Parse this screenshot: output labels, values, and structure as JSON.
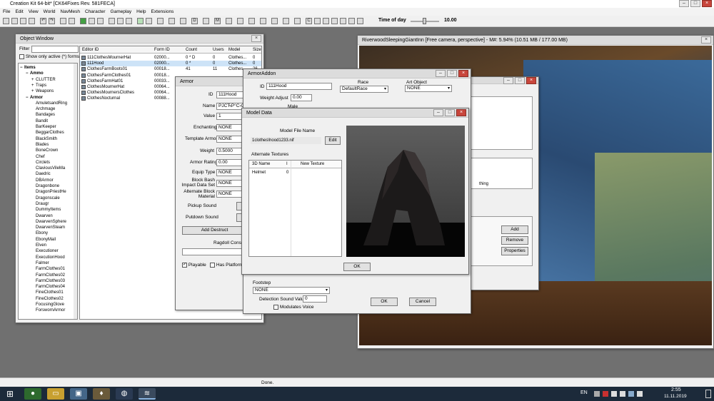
{
  "app": {
    "title": "Creation Kit 64-bit* [CK64Fixes Rev. 581FECA]",
    "menu": [
      "File",
      "Edit",
      "View",
      "World",
      "NavMesh",
      "Character",
      "Gameplay",
      "Help",
      "Extensions"
    ],
    "time_of_day_label": "Time of day",
    "time_of_day_value": "10.00",
    "status": "Done."
  },
  "object_window": {
    "title": "Object Window",
    "filter_label": "Filter",
    "show_active_label": "Show only active (*) forms",
    "tree": [
      {
        "label": "Items",
        "level": 0,
        "expander": "−"
      },
      {
        "label": "Ammo",
        "level": 1,
        "expander": "−"
      },
      {
        "label": "CLUTTER",
        "level": 2,
        "expander": "+"
      },
      {
        "label": "Traps",
        "level": 2,
        "expander": "+"
      },
      {
        "label": "Weapons",
        "level": 2,
        "expander": "+"
      },
      {
        "label": "Armor",
        "level": 1,
        "expander": "−"
      },
      {
        "label": "AmuletsandRing",
        "level": 2,
        "expander": ""
      },
      {
        "label": "Archmage",
        "level": 2,
        "expander": ""
      },
      {
        "label": "Bandages",
        "level": 2,
        "expander": ""
      },
      {
        "label": "Bandit",
        "level": 2,
        "expander": ""
      },
      {
        "label": "BarKeeper",
        "level": 2,
        "expander": ""
      },
      {
        "label": "BeggarClothes",
        "level": 2,
        "expander": ""
      },
      {
        "label": "BlackSmith",
        "level": 2,
        "expander": ""
      },
      {
        "label": "Blades",
        "level": 2,
        "expander": ""
      },
      {
        "label": "BoneCrown",
        "level": 2,
        "expander": ""
      },
      {
        "label": "Chef",
        "level": 2,
        "expander": ""
      },
      {
        "label": "Circlets",
        "level": 2,
        "expander": ""
      },
      {
        "label": "ClaviousVileMa",
        "level": 2,
        "expander": ""
      },
      {
        "label": "Daedric",
        "level": 2,
        "expander": ""
      },
      {
        "label": "DBArmor",
        "level": 2,
        "expander": ""
      },
      {
        "label": "Dragonbone",
        "level": 2,
        "expander": ""
      },
      {
        "label": "DragonPriestHe",
        "level": 2,
        "expander": ""
      },
      {
        "label": "Dragonscale",
        "level": 2,
        "expander": ""
      },
      {
        "label": "Draugr",
        "level": 2,
        "expander": ""
      },
      {
        "label": "DummyItems",
        "level": 2,
        "expander": ""
      },
      {
        "label": "Dwarven",
        "level": 2,
        "expander": ""
      },
      {
        "label": "DwarvenSphere",
        "level": 2,
        "expander": ""
      },
      {
        "label": "DwarvenSteam",
        "level": 2,
        "expander": ""
      },
      {
        "label": "Ebony",
        "level": 2,
        "expander": ""
      },
      {
        "label": "EbonyMail",
        "level": 2,
        "expander": ""
      },
      {
        "label": "Elven",
        "level": 2,
        "expander": ""
      },
      {
        "label": "Executioner",
        "level": 2,
        "expander": ""
      },
      {
        "label": "ExecutionHood",
        "level": 2,
        "expander": ""
      },
      {
        "label": "Falmer",
        "level": 2,
        "expander": ""
      },
      {
        "label": "FarmClothes01",
        "level": 2,
        "expander": ""
      },
      {
        "label": "FarmClothes02",
        "level": 2,
        "expander": ""
      },
      {
        "label": "FarmClothes03",
        "level": 2,
        "expander": ""
      },
      {
        "label": "FarmClothes04",
        "level": 2,
        "expander": ""
      },
      {
        "label": "FineClothes01",
        "level": 2,
        "expander": ""
      },
      {
        "label": "FineClothes02",
        "level": 2,
        "expander": ""
      },
      {
        "label": "FocusingGlove",
        "level": 2,
        "expander": ""
      },
      {
        "label": "ForswornArmor",
        "level": 2,
        "expander": ""
      }
    ],
    "columns": [
      "Editor ID",
      "Form ID",
      "Count",
      "Users",
      "Model",
      "Size"
    ],
    "rows": [
      [
        "111ClothesMournerHat",
        "02000...",
        "0 * D",
        "0",
        "Clothes...",
        "0"
      ],
      [
        "111Hood",
        "02000...",
        "0 *",
        "0",
        "Clothes...",
        "0"
      ],
      [
        "ClothesFarmBoots01",
        "00018...",
        "41",
        "11",
        "Clothes...",
        "26"
      ],
      [
        "ClothesFarmClothes01",
        "00018...",
        "",
        "",
        "",
        ""
      ],
      [
        "ClothesFarmHat01",
        "00033...",
        "",
        "",
        "",
        ""
      ],
      [
        "ClothesMournerHat",
        "00064...",
        "",
        "",
        "",
        ""
      ],
      [
        "ClothesMournersClothes",
        "00064...",
        "",
        "",
        "",
        ""
      ],
      [
        "ClothesNocturnal",
        "00088...",
        "",
        "",
        "",
        ""
      ]
    ]
  },
  "armor_window": {
    "title": "Armor",
    "id_label": "ID",
    "id_value": "111Hood",
    "name_label": "Name",
    "name_value": "РЈСЋР°С‹СЂ",
    "value_label": "Value",
    "value_value": "1",
    "enchanting_label": "Enchanting",
    "enchanting_value": "NONE",
    "template_label": "Template Armor",
    "template_value": "NONE",
    "weight_label": "Weight",
    "weight_value": "0.5000",
    "rating_label": "Armor Rating",
    "rating_value": "0.00",
    "equip_label": "Equip Type",
    "equip_value": "NONE",
    "bash_label": "Block Bash Impact Data Set",
    "bash_value": "NONE",
    "altblock_label": "Alternate Block Material",
    "altblock_value": "NONE",
    "pickup_label": "Pickup Sound",
    "putdown_label": "Putdown Sound",
    "destruct_btn": "Add Destruct",
    "ragdoll_label": "Ragdoll Constr",
    "playable_label": "Playable",
    "platform_label": "Has Platform"
  },
  "armor_addon": {
    "title": "ArmorAddon",
    "id_label": "ID",
    "id_value": "111Hood",
    "race_label": "Race",
    "race_value": "DefaultRace",
    "art_label": "Art Object",
    "art_value": "NONE",
    "weight_adjust_label": "Weight Adjust",
    "weight_adjust_value": "0.00",
    "male_label": "Male",
    "footstep_label": "Footstep",
    "footstep_value": "NONE",
    "detection_label": "Detection Sound Value",
    "detection_value": "0",
    "modulates_label": "Modulates Voice",
    "ok": "OK",
    "cancel": "Cancel"
  },
  "model_data": {
    "title": "Model Data",
    "file_label": "Model File Name",
    "file_value": "1clothes\\hood1233.nif",
    "edit_btn": "Edit",
    "alt_label": "Alternate Textures",
    "col_name": "3D Name",
    "col_idx": "I",
    "col_tex": "New Texture",
    "row_name": "Helmet",
    "row_idx": "0",
    "ok": "OK"
  },
  "render_window": {
    "title": "RiverwoodSleepingGiantInn [Free camera, perspective] - M#: 5.94% (10.51 MB / 177.00 MB)"
  },
  "back_window": {
    "clothing_text": "thing",
    "add_btn": "Add",
    "remove_btn": "Remove",
    "properties_btn": "Properties"
  },
  "taskbar": {
    "lang": "EN",
    "time": "2:55",
    "date": "11.11.2019"
  }
}
